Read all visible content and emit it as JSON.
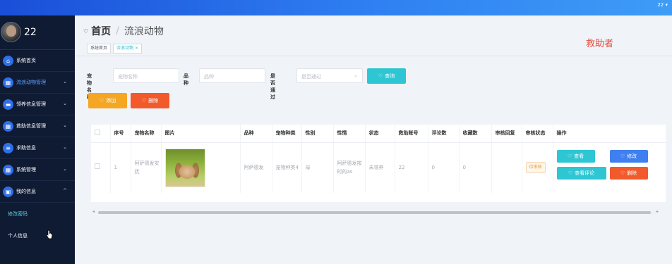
{
  "topbar": {
    "user": "22 ▾"
  },
  "sidebar": {
    "username": "22",
    "menu": [
      {
        "label": "系统首页",
        "icon": "home-icon",
        "glyph": "⌂",
        "has_arrow": false,
        "active": false
      },
      {
        "label": "流浪动物管理",
        "icon": "grid-icon",
        "glyph": "▦",
        "has_arrow": true,
        "active": true
      },
      {
        "label": "领养信息管理",
        "icon": "ticket-icon",
        "glyph": "▬",
        "has_arrow": true,
        "active": false
      },
      {
        "label": "救助信息管理",
        "icon": "grid-icon",
        "glyph": "▦",
        "has_arrow": true,
        "active": false
      },
      {
        "label": "求助信息",
        "icon": "list-icon",
        "glyph": "≡",
        "has_arrow": true,
        "active": false
      },
      {
        "label": "系统管理",
        "icon": "grid-icon",
        "glyph": "▦",
        "has_arrow": true,
        "active": false
      },
      {
        "label": "我的信息",
        "icon": "calendar-icon",
        "glyph": "▣",
        "has_arrow": true,
        "arrow": "^",
        "active": false
      }
    ],
    "submenu": [
      {
        "label": "修改密码",
        "active": true
      },
      {
        "label": "个人信息",
        "active": false
      }
    ]
  },
  "header": {
    "home": "首页",
    "separator": "/",
    "current": "流浪动物",
    "role": "救助者"
  },
  "tabs": [
    {
      "label": "系统首页",
      "active": false,
      "closable": false
    },
    {
      "label": "流浪动物",
      "active": true,
      "closable": true,
      "close": "×"
    }
  ],
  "filters": {
    "name_label": "宠物名称",
    "name_placeholder": "宠物名称",
    "breed_label": "品种",
    "breed_placeholder": "品种",
    "approved_label": "是否通过",
    "approved_placeholder": "是否通过",
    "search_button": "查询"
  },
  "actions": {
    "add": "添加",
    "delete": "删除"
  },
  "table": {
    "columns": [
      "",
      "序号",
      "宠物名称",
      "图片",
      "品种",
      "宠物种类",
      "性别",
      "性情",
      "状态",
      "救助账号",
      "评论数",
      "收藏数",
      "审核回复",
      "审核状态",
      "操作"
    ],
    "rows": [
      {
        "index": "1",
        "name": "阿萨德发安抚",
        "breed": "阿萨德发",
        "type": "宠物种类4",
        "gender": "母",
        "temperament": "阿萨德发按时的as",
        "status": "未领养",
        "account": "22",
        "comments": "0",
        "favorites": "0",
        "reply": "",
        "audit": "待审核",
        "ops": {
          "view": "查看",
          "edit": "修改",
          "comment": "查看评论",
          "delete": "删除"
        }
      }
    ]
  },
  "colors": {
    "accent": "#2ec6d2",
    "primary": "#3f7ff0",
    "warning": "#f5a623",
    "danger": "#f25a2c",
    "sidebar": "#0f1a33",
    "role": "#e64a3b"
  }
}
